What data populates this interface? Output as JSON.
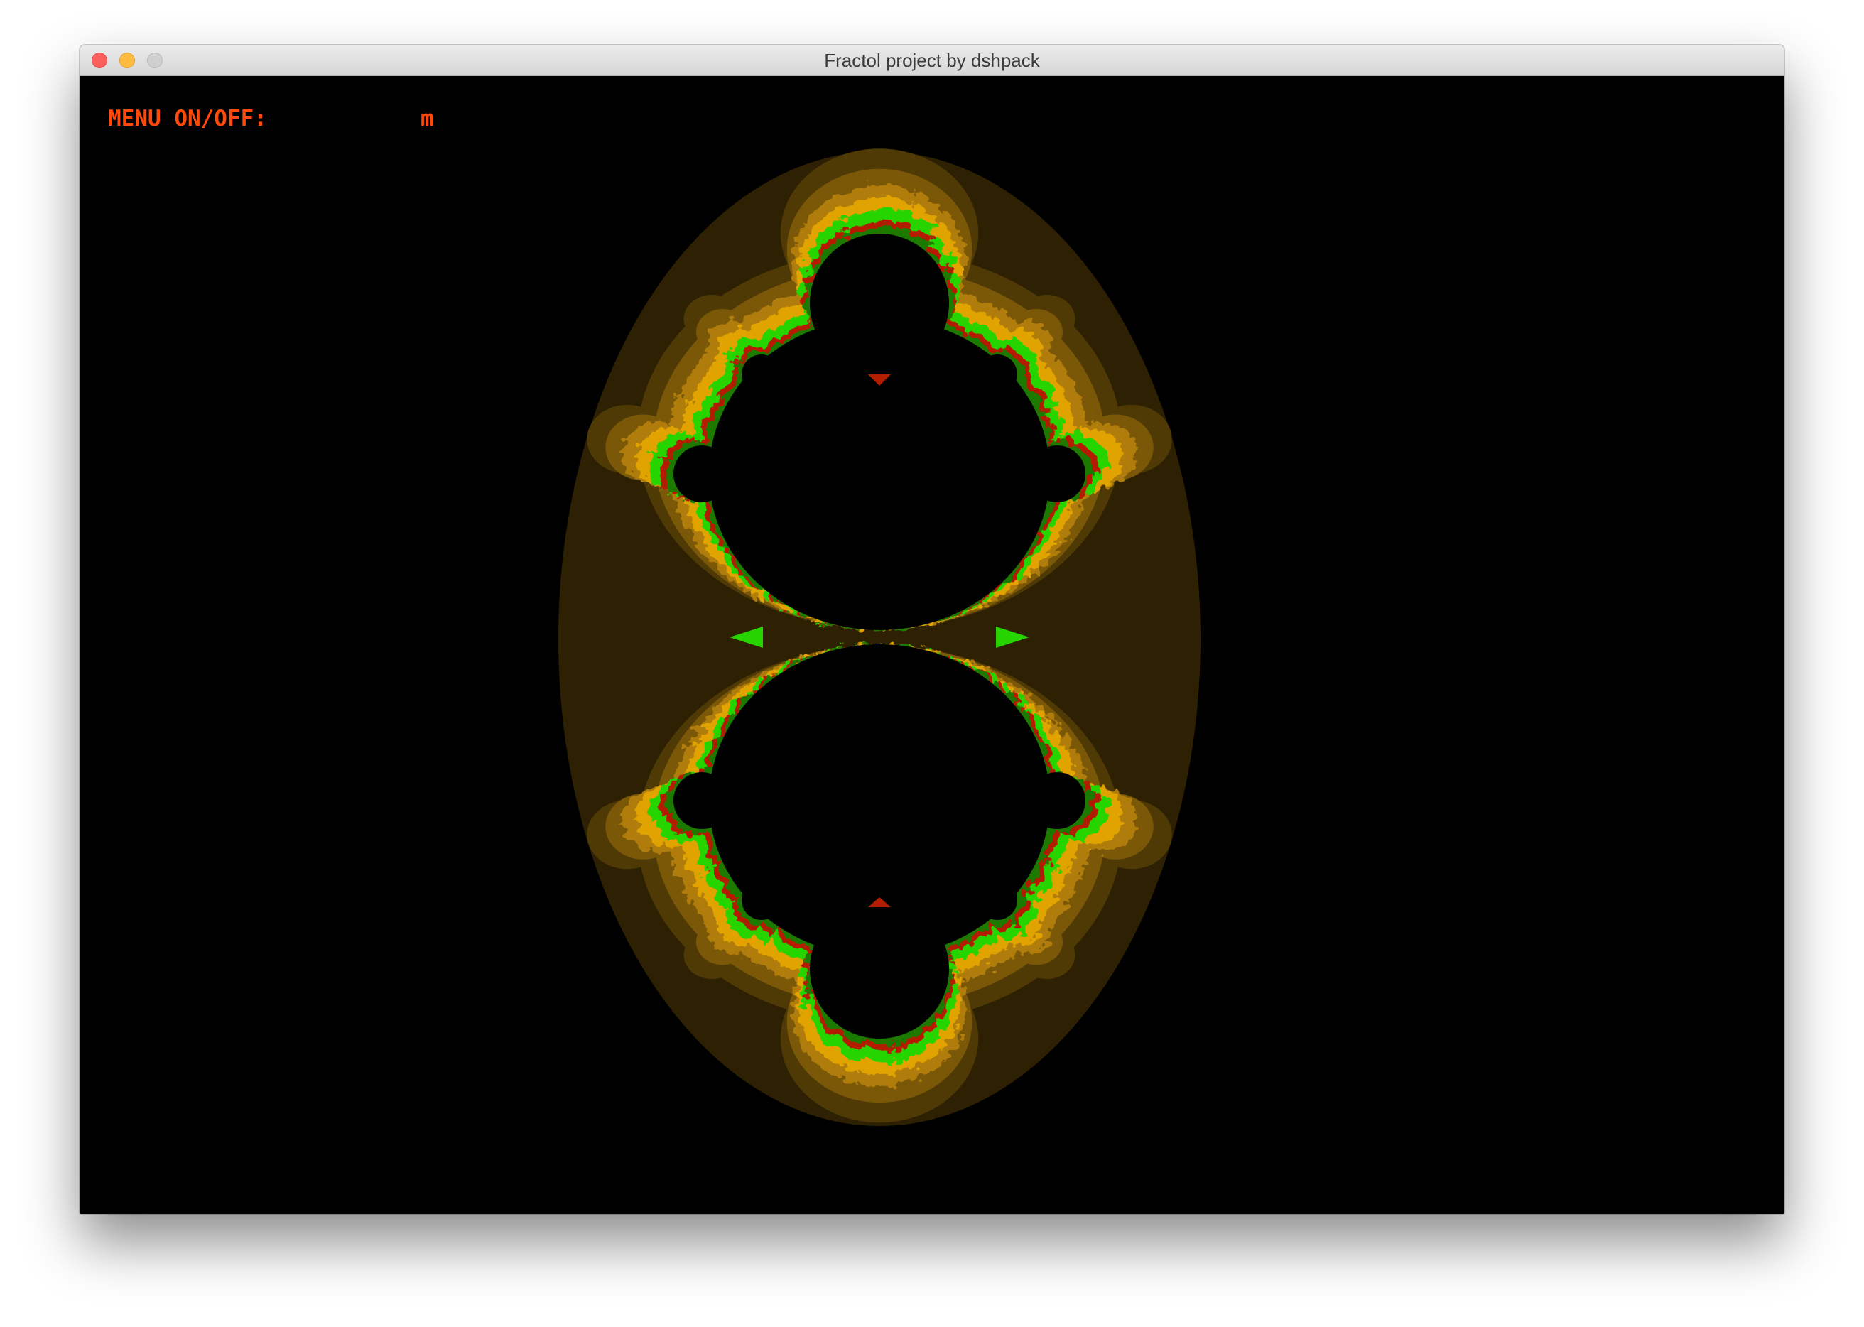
{
  "window": {
    "title": "Fractol project by dshpack"
  },
  "menu": {
    "label": "MENU ON/OFF:",
    "key": "m"
  },
  "colors": {
    "background": "#000000",
    "menu_text": "#ff4a0a",
    "band_outer": "#2e2103",
    "band_2": "#4f3a06",
    "band_3": "#7a5808",
    "band_4": "#b07d08",
    "band_5": "#e0a300",
    "edge_green": "#27d400",
    "edge_red": "#b31d00"
  },
  "icons": {
    "close": "close-button",
    "minimize": "minimize-button",
    "zoom": "zoom-button"
  }
}
